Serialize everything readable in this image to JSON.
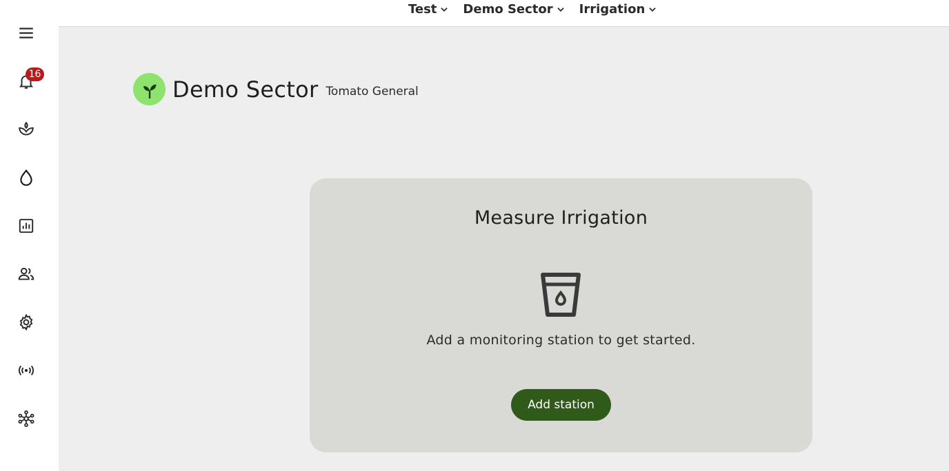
{
  "topbar": {
    "crumbs": [
      {
        "label": "Test"
      },
      {
        "label": "Demo Sector"
      },
      {
        "label": "Irrigation"
      }
    ]
  },
  "sidebar": {
    "notifications_count": "16",
    "items": [
      {
        "icon": "menu-icon"
      },
      {
        "icon": "bell-icon"
      },
      {
        "icon": "sprout-icon"
      },
      {
        "icon": "water-drop-icon"
      },
      {
        "icon": "bar-chart-icon"
      },
      {
        "icon": "people-icon"
      },
      {
        "icon": "gear-icon"
      },
      {
        "icon": "broadcast-icon"
      },
      {
        "icon": "network-icon"
      }
    ]
  },
  "header": {
    "title": "Demo Sector",
    "subtitle": "Tomato General",
    "avatar_color": "#8de36e"
  },
  "card": {
    "title": "Measure Irrigation",
    "icon": "water-glass-icon",
    "message": "Add a monitoring station to get started.",
    "button_label": "Add station",
    "button_color": "#2f5a19"
  }
}
